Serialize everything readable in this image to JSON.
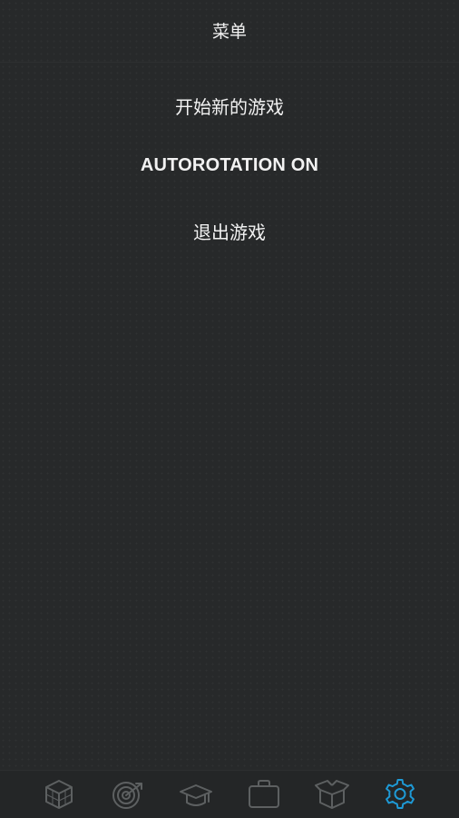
{
  "header": {
    "title": "菜单"
  },
  "menu": {
    "items": [
      {
        "label": "开始新的游戏"
      },
      {
        "label": "AUTOROTATION ON"
      },
      {
        "label": "退出游戏"
      }
    ]
  },
  "tabbar": {
    "tabs": [
      {
        "icon": "cube-icon",
        "active": false
      },
      {
        "icon": "target-icon",
        "active": false
      },
      {
        "icon": "graduation-cap-icon",
        "active": false
      },
      {
        "icon": "briefcase-icon",
        "active": false
      },
      {
        "icon": "open-box-icon",
        "active": false
      },
      {
        "icon": "gear-icon",
        "active": true
      }
    ],
    "inactive_color": "#5d6061",
    "active_color": "#1e9ad6"
  }
}
